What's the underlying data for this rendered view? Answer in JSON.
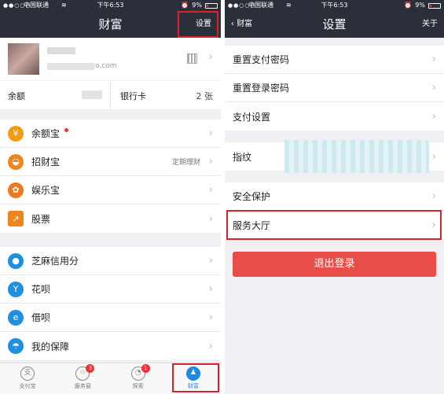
{
  "status": {
    "carrier": "中国联通",
    "time": "下午6:53",
    "battery": "9%",
    "dots": "●●○○○"
  },
  "left": {
    "title": "财富",
    "settings_label": "设置",
    "profile": {
      "email_suffix": "o.com"
    },
    "balance": {
      "label": "余额",
      "bankcard_label": "银行卡",
      "bankcard_count": "2 张"
    },
    "group1": [
      {
        "label": "余额宝",
        "icon": "yuebao-icon",
        "color": "#f39c12",
        "glyph": "¥",
        "dot": true,
        "sub": ""
      },
      {
        "label": "招财宝",
        "icon": "zhaocaibao-icon",
        "color": "#f0851e",
        "glyph": "◒",
        "dot": false,
        "sub": "定期理财"
      },
      {
        "label": "娱乐宝",
        "icon": "yulebao-icon",
        "color": "#ee7a1e",
        "glyph": "✿",
        "dot": false,
        "sub": ""
      },
      {
        "label": "股票",
        "icon": "stock-icon",
        "color": "#f0851e",
        "glyph": "↗",
        "dot": false,
        "sub": ""
      }
    ],
    "group2": [
      {
        "label": "芝麻信用分",
        "icon": "sesame-credit-icon",
        "color": "#1e90e0",
        "glyph": "●",
        "sub": ""
      },
      {
        "label": "花呗",
        "icon": "huabei-icon",
        "color": "#1e90e0",
        "glyph": "Y",
        "sub": ""
      },
      {
        "label": "借呗",
        "icon": "jiebei-icon",
        "color": "#1e90e0",
        "glyph": "e",
        "sub": ""
      },
      {
        "label": "我的保障",
        "icon": "umbrella-icon",
        "color": "#1e90e0",
        "glyph": "☂",
        "sub": ""
      }
    ],
    "tabs": [
      {
        "label": "支付宝",
        "glyph": "支",
        "badge": "",
        "active": false,
        "icon": "alipay-tab-icon"
      },
      {
        "label": "服务窗",
        "glyph": "☆",
        "badge": "3",
        "active": false,
        "icon": "service-window-tab-icon"
      },
      {
        "label": "探索",
        "glyph": "◔",
        "badge": "1",
        "active": false,
        "icon": "explore-tab-icon"
      },
      {
        "label": "财富",
        "glyph": "♟",
        "badge": "",
        "active": true,
        "icon": "wealth-tab-icon"
      }
    ]
  },
  "right": {
    "back_label": "财富",
    "title": "设置",
    "about_label": "关于",
    "group1": [
      "重置支付密码",
      "重置登录密码",
      "支付设置"
    ],
    "fingerprint_label": "指纹",
    "group3": [
      "安全保护",
      "服务大厅"
    ],
    "logout_label": "退出登录"
  },
  "colors": {
    "header": "#2b2f3a",
    "highlight": "#d9222a",
    "logout": "#e84d48",
    "accent": "#1e88e5"
  }
}
